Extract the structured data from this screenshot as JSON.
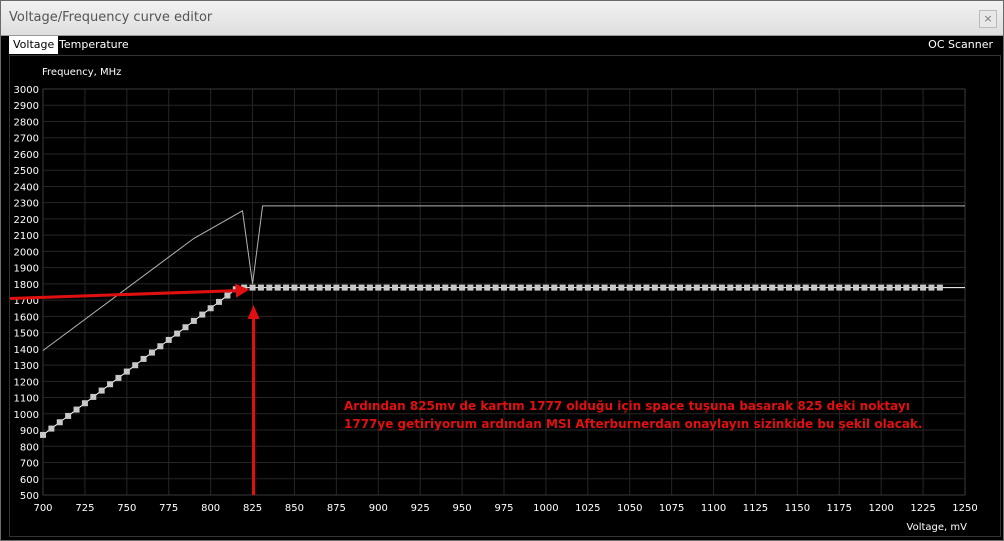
{
  "window": {
    "title": "Voltage/Frequency curve editor",
    "close_glyph": "×"
  },
  "tabs": [
    {
      "label": "Voltage",
      "active": true
    },
    {
      "label": "Temperature",
      "active": false
    }
  ],
  "oc_scanner_label": "OC Scanner",
  "annotation": {
    "line1": "Ardından 825mv de kartım 1777 olduğu için space tuşuna basarak 825 deki noktayı",
    "line2": "1777ye getiriyorum ardından MSI Afterburnerdan onaylayın sizinkide bu şekil olacak.",
    "color": "#e01010"
  },
  "chart_data": {
    "type": "line",
    "ylabel": "Frequency, MHz",
    "xlabel": "Voltage, mV",
    "xlim": [
      700,
      1250
    ],
    "ylim": [
      500,
      3000
    ],
    "x_ticks": [
      700,
      725,
      750,
      775,
      800,
      825,
      850,
      875,
      900,
      925,
      950,
      975,
      1000,
      1025,
      1050,
      1075,
      1100,
      1125,
      1150,
      1175,
      1200,
      1225,
      1250
    ],
    "y_ticks": [
      500,
      600,
      700,
      800,
      900,
      1000,
      1100,
      1200,
      1300,
      1400,
      1500,
      1600,
      1700,
      1800,
      1900,
      2000,
      2100,
      2200,
      2300,
      2400,
      2500,
      2600,
      2700,
      2800,
      2900,
      3000
    ],
    "grid": true,
    "series": [
      {
        "style": "reference-line",
        "color": "#b4b4b4",
        "points": [
          [
            700,
            1390
          ],
          [
            790,
            2080
          ],
          [
            819,
            2250
          ],
          [
            825,
            1800
          ],
          [
            831,
            2280
          ],
          [
            1250,
            2280
          ]
        ]
      },
      {
        "style": "curve-points",
        "color": "#c8c8c8",
        "points": [
          [
            700,
            870
          ],
          [
            705,
            909
          ],
          [
            710,
            948
          ],
          [
            715,
            987
          ],
          [
            720,
            1026
          ],
          [
            725,
            1065
          ],
          [
            730,
            1104
          ],
          [
            735,
            1143
          ],
          [
            740,
            1182
          ],
          [
            745,
            1221
          ],
          [
            750,
            1260
          ],
          [
            755,
            1299
          ],
          [
            760,
            1338
          ],
          [
            765,
            1377
          ],
          [
            770,
            1416
          ],
          [
            775,
            1455
          ],
          [
            780,
            1494
          ],
          [
            785,
            1533
          ],
          [
            790,
            1572
          ],
          [
            795,
            1611
          ],
          [
            800,
            1650
          ],
          [
            805,
            1689
          ],
          [
            810,
            1728
          ],
          [
            815,
            1767
          ],
          [
            820,
            1777
          ],
          [
            825,
            1777
          ],
          [
            1250,
            1777
          ]
        ]
      }
    ]
  }
}
